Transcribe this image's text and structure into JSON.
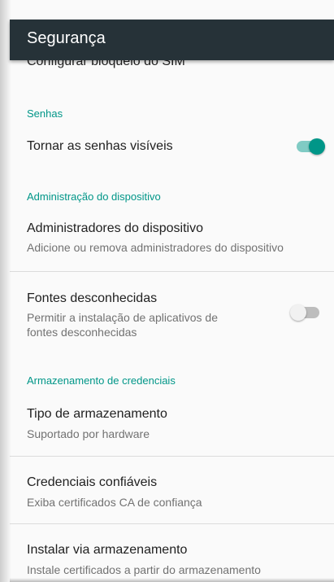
{
  "appbar": {
    "title": "Segurança"
  },
  "items": {
    "sim_lock": {
      "title": "Configurar bloqueio do SIM"
    },
    "passwords_header": "Senhas",
    "show_passwords": {
      "title": "Tornar as senhas visíveis",
      "enabled": true
    },
    "device_admin_header": "Administração do dispositivo",
    "device_admins": {
      "title": "Administradores do dispositivo",
      "summary": "Adicione ou remova administradores do dispositivo"
    },
    "unknown_sources": {
      "title": "Fontes desconhecidas",
      "summary_line1": "Permitir a instalação de aplicativos de",
      "summary_line2": "fontes desconhecidas",
      "enabled": false
    },
    "credential_storage_header": "Armazenamento de credenciais",
    "storage_type": {
      "title": "Tipo de armazenamento",
      "summary": "Suportado por hardware"
    },
    "trusted_credentials": {
      "title": "Credenciais confiáveis",
      "summary": "Exiba certificados CA de confiança"
    },
    "install_from_storage": {
      "title": "Instalar via armazenamento",
      "summary": "Instale certificados a partir do armazenamento"
    }
  },
  "colors": {
    "appbar": "#263238",
    "accent": "#009688",
    "accent_track": "#80cbc4"
  }
}
